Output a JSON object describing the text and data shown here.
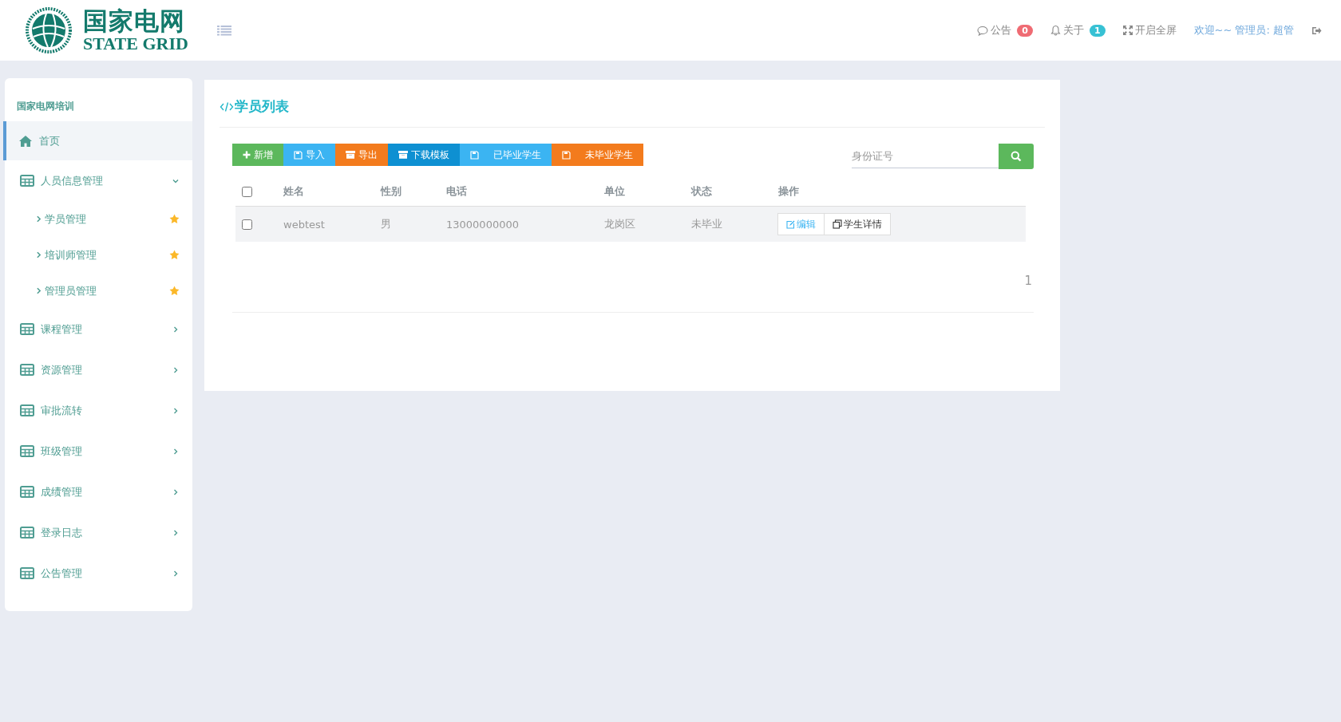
{
  "header": {
    "logo": {
      "name": "国家电网",
      "name_en": "STATE GRID"
    },
    "notices": [
      {
        "kind": "chat",
        "label": "公告",
        "badge": "0",
        "color": "#ef6b73"
      },
      {
        "kind": "bell",
        "label": "关于",
        "badge": "1",
        "color": "#37c1d4"
      }
    ],
    "fullscreen": "开启全屏",
    "welcome": "欢迎~~ 管理员: 超管"
  },
  "sidebar": {
    "title": "国家电网培训",
    "items": [
      {
        "kind": "home",
        "label": "首页",
        "selected": true
      },
      {
        "kind": "group",
        "label": "人员信息管理",
        "selected": false,
        "expanded": true,
        "children": [
          {
            "label": "学员管理",
            "selected": false
          },
          {
            "label": "培训师管理",
            "selected": false
          },
          {
            "label": "管理员管理",
            "selected": false
          }
        ]
      },
      {
        "kind": "group",
        "label": "课程管理",
        "selected": false,
        "expanded": false
      },
      {
        "kind": "group",
        "label": "资源管理",
        "selected": false,
        "expanded": false
      },
      {
        "kind": "group",
        "label": "审批流转",
        "selected": false,
        "expanded": false
      },
      {
        "kind": "group",
        "label": "班级管理",
        "selected": false,
        "expanded": false
      },
      {
        "kind": "group",
        "label": "成绩管理",
        "selected": false,
        "expanded": false
      },
      {
        "kind": "group",
        "label": "登录日志",
        "selected": false,
        "expanded": false
      },
      {
        "kind": "group",
        "label": "公告管理",
        "selected": false,
        "expanded": false
      }
    ]
  },
  "panel": {
    "title": "学员列表",
    "toolbar": [
      {
        "kind": "add",
        "label": "新增",
        "color": "#5cb85c"
      },
      {
        "kind": "save",
        "label": "导入",
        "color": "#3bb4f2"
      },
      {
        "kind": "archive",
        "label": "导出",
        "color": "#f37b1d"
      },
      {
        "kind": "archive",
        "label": "下载模板",
        "color": "#0e90d2"
      },
      {
        "kind": "save",
        "label": "已毕业学生",
        "color": "#3bb4f2"
      },
      {
        "kind": "save",
        "label": "未毕业学生",
        "color": "#f37b1d"
      }
    ],
    "search": {
      "placeholder": "身份证号"
    },
    "table": {
      "all_checked": false,
      "columns": [
        "姓名",
        "性别",
        "电话",
        "单位",
        "状态",
        "操作"
      ],
      "rows": [
        {
          "checked": false,
          "cells": [
            "webtest",
            "男",
            "13000000000",
            "龙岗区",
            "未毕业"
          ],
          "actions": [
            {
              "kind": "edit",
              "label": "编辑"
            },
            {
              "kind": "detail",
              "label": "学生详情"
            }
          ]
        }
      ]
    },
    "pagination": [
      "1"
    ]
  }
}
